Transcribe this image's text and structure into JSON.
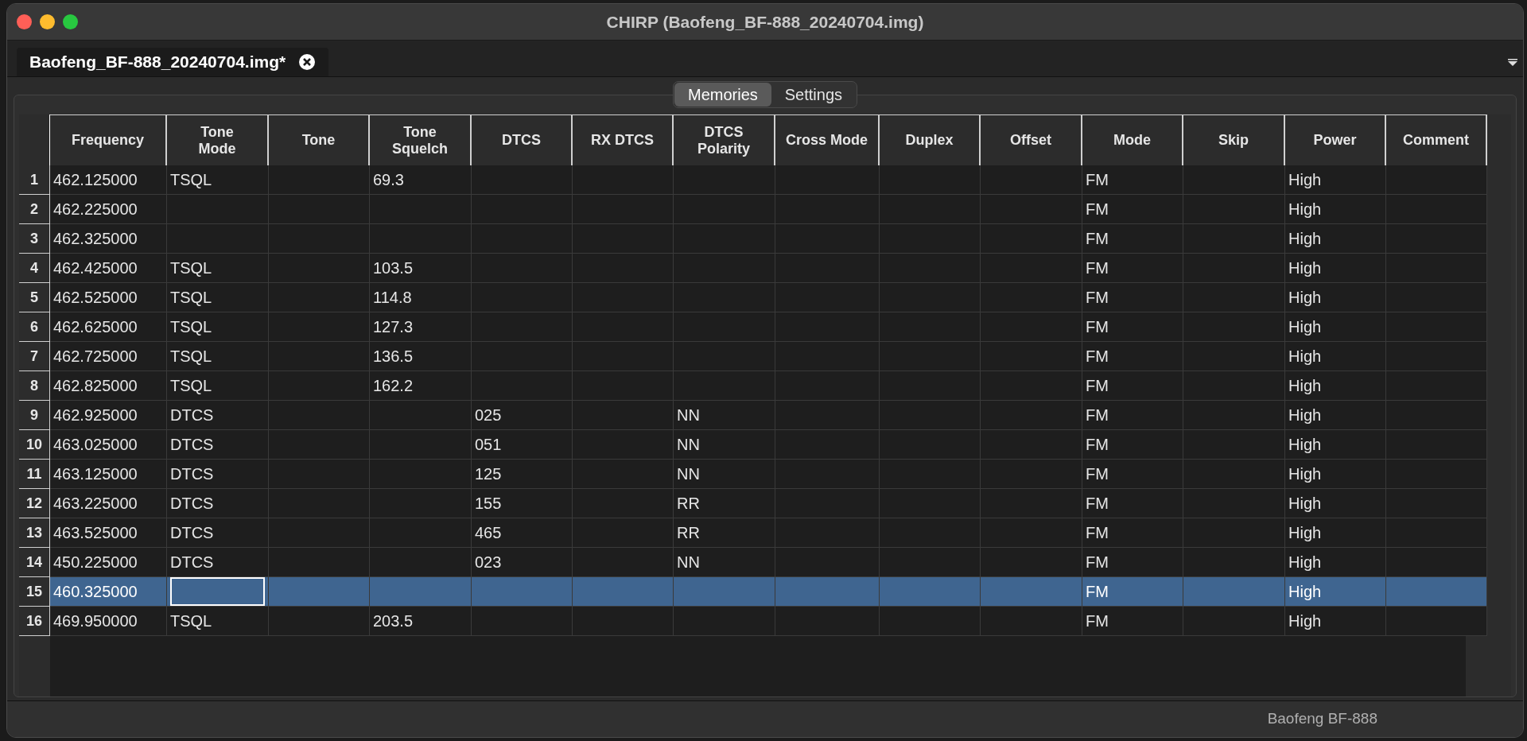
{
  "window": {
    "title": "CHIRP (Baofeng_BF-888_20240704.img)"
  },
  "file_tabs": [
    {
      "label": "Baofeng_BF-888_20240704.img*",
      "selected": true
    }
  ],
  "tabs": [
    {
      "label": "Memories",
      "selected": true
    },
    {
      "label": "Settings",
      "selected": false
    }
  ],
  "table": {
    "columns": [
      "Frequency",
      "Tone\nMode",
      "Tone",
      "Tone\nSquelch",
      "DTCS",
      "RX DTCS",
      "DTCS\nPolarity",
      "Cross Mode",
      "Duplex",
      "Offset",
      "Mode",
      "Skip",
      "Power",
      "Comment"
    ],
    "rows": [
      {
        "number": "1",
        "selected": false,
        "cells": [
          "462.125000",
          "TSQL",
          null,
          "69.3",
          null,
          null,
          null,
          null,
          null,
          null,
          "FM",
          null,
          "High",
          null
        ]
      },
      {
        "number": "2",
        "selected": false,
        "cells": [
          "462.225000",
          null,
          null,
          null,
          null,
          null,
          null,
          null,
          null,
          null,
          "FM",
          null,
          "High",
          null
        ]
      },
      {
        "number": "3",
        "selected": false,
        "cells": [
          "462.325000",
          null,
          null,
          null,
          null,
          null,
          null,
          null,
          null,
          null,
          "FM",
          null,
          "High",
          null
        ]
      },
      {
        "number": "4",
        "selected": false,
        "cells": [
          "462.425000",
          "TSQL",
          null,
          "103.5",
          null,
          null,
          null,
          null,
          null,
          null,
          "FM",
          null,
          "High",
          null
        ]
      },
      {
        "number": "5",
        "selected": false,
        "cells": [
          "462.525000",
          "TSQL",
          null,
          "114.8",
          null,
          null,
          null,
          null,
          null,
          null,
          "FM",
          null,
          "High",
          null
        ]
      },
      {
        "number": "6",
        "selected": false,
        "cells": [
          "462.625000",
          "TSQL",
          null,
          "127.3",
          null,
          null,
          null,
          null,
          null,
          null,
          "FM",
          null,
          "High",
          null
        ]
      },
      {
        "number": "7",
        "selected": false,
        "cells": [
          "462.725000",
          "TSQL",
          null,
          "136.5",
          null,
          null,
          null,
          null,
          null,
          null,
          "FM",
          null,
          "High",
          null
        ]
      },
      {
        "number": "8",
        "selected": false,
        "cells": [
          "462.825000",
          "TSQL",
          null,
          "162.2",
          null,
          null,
          null,
          null,
          null,
          null,
          "FM",
          null,
          "High",
          null
        ]
      },
      {
        "number": "9",
        "selected": false,
        "cells": [
          "462.925000",
          "DTCS",
          null,
          null,
          "025",
          null,
          "NN",
          null,
          null,
          null,
          "FM",
          null,
          "High",
          null
        ]
      },
      {
        "number": "10",
        "selected": false,
        "cells": [
          "463.025000",
          "DTCS",
          null,
          null,
          "051",
          null,
          "NN",
          null,
          null,
          null,
          "FM",
          null,
          "High",
          null
        ]
      },
      {
        "number": "11",
        "selected": false,
        "cells": [
          "463.125000",
          "DTCS",
          null,
          null,
          "125",
          null,
          "NN",
          null,
          null,
          null,
          "FM",
          null,
          "High",
          null
        ]
      },
      {
        "number": "12",
        "selected": false,
        "cells": [
          "463.225000",
          "DTCS",
          null,
          null,
          "155",
          null,
          "RR",
          null,
          null,
          null,
          "FM",
          null,
          "High",
          null
        ]
      },
      {
        "number": "13",
        "selected": false,
        "cells": [
          "463.525000",
          "DTCS",
          null,
          null,
          "465",
          null,
          "RR",
          null,
          null,
          null,
          "FM",
          null,
          "High",
          null
        ]
      },
      {
        "number": "14",
        "selected": false,
        "cells": [
          "450.225000",
          "DTCS",
          null,
          null,
          "023",
          null,
          "NN",
          null,
          null,
          null,
          "FM",
          null,
          "High",
          null
        ]
      },
      {
        "number": "15",
        "selected": true,
        "cells": [
          "460.325000",
          {
            "focused": true
          },
          null,
          null,
          null,
          null,
          null,
          null,
          null,
          null,
          "FM",
          null,
          "High",
          null
        ]
      },
      {
        "number": "16",
        "selected": false,
        "cells": [
          "469.950000",
          "TSQL",
          null,
          "203.5",
          null,
          null,
          null,
          null,
          null,
          null,
          "FM",
          null,
          "High",
          null
        ]
      }
    ]
  },
  "status_bar": {
    "text": "Baofeng BF-888"
  }
}
